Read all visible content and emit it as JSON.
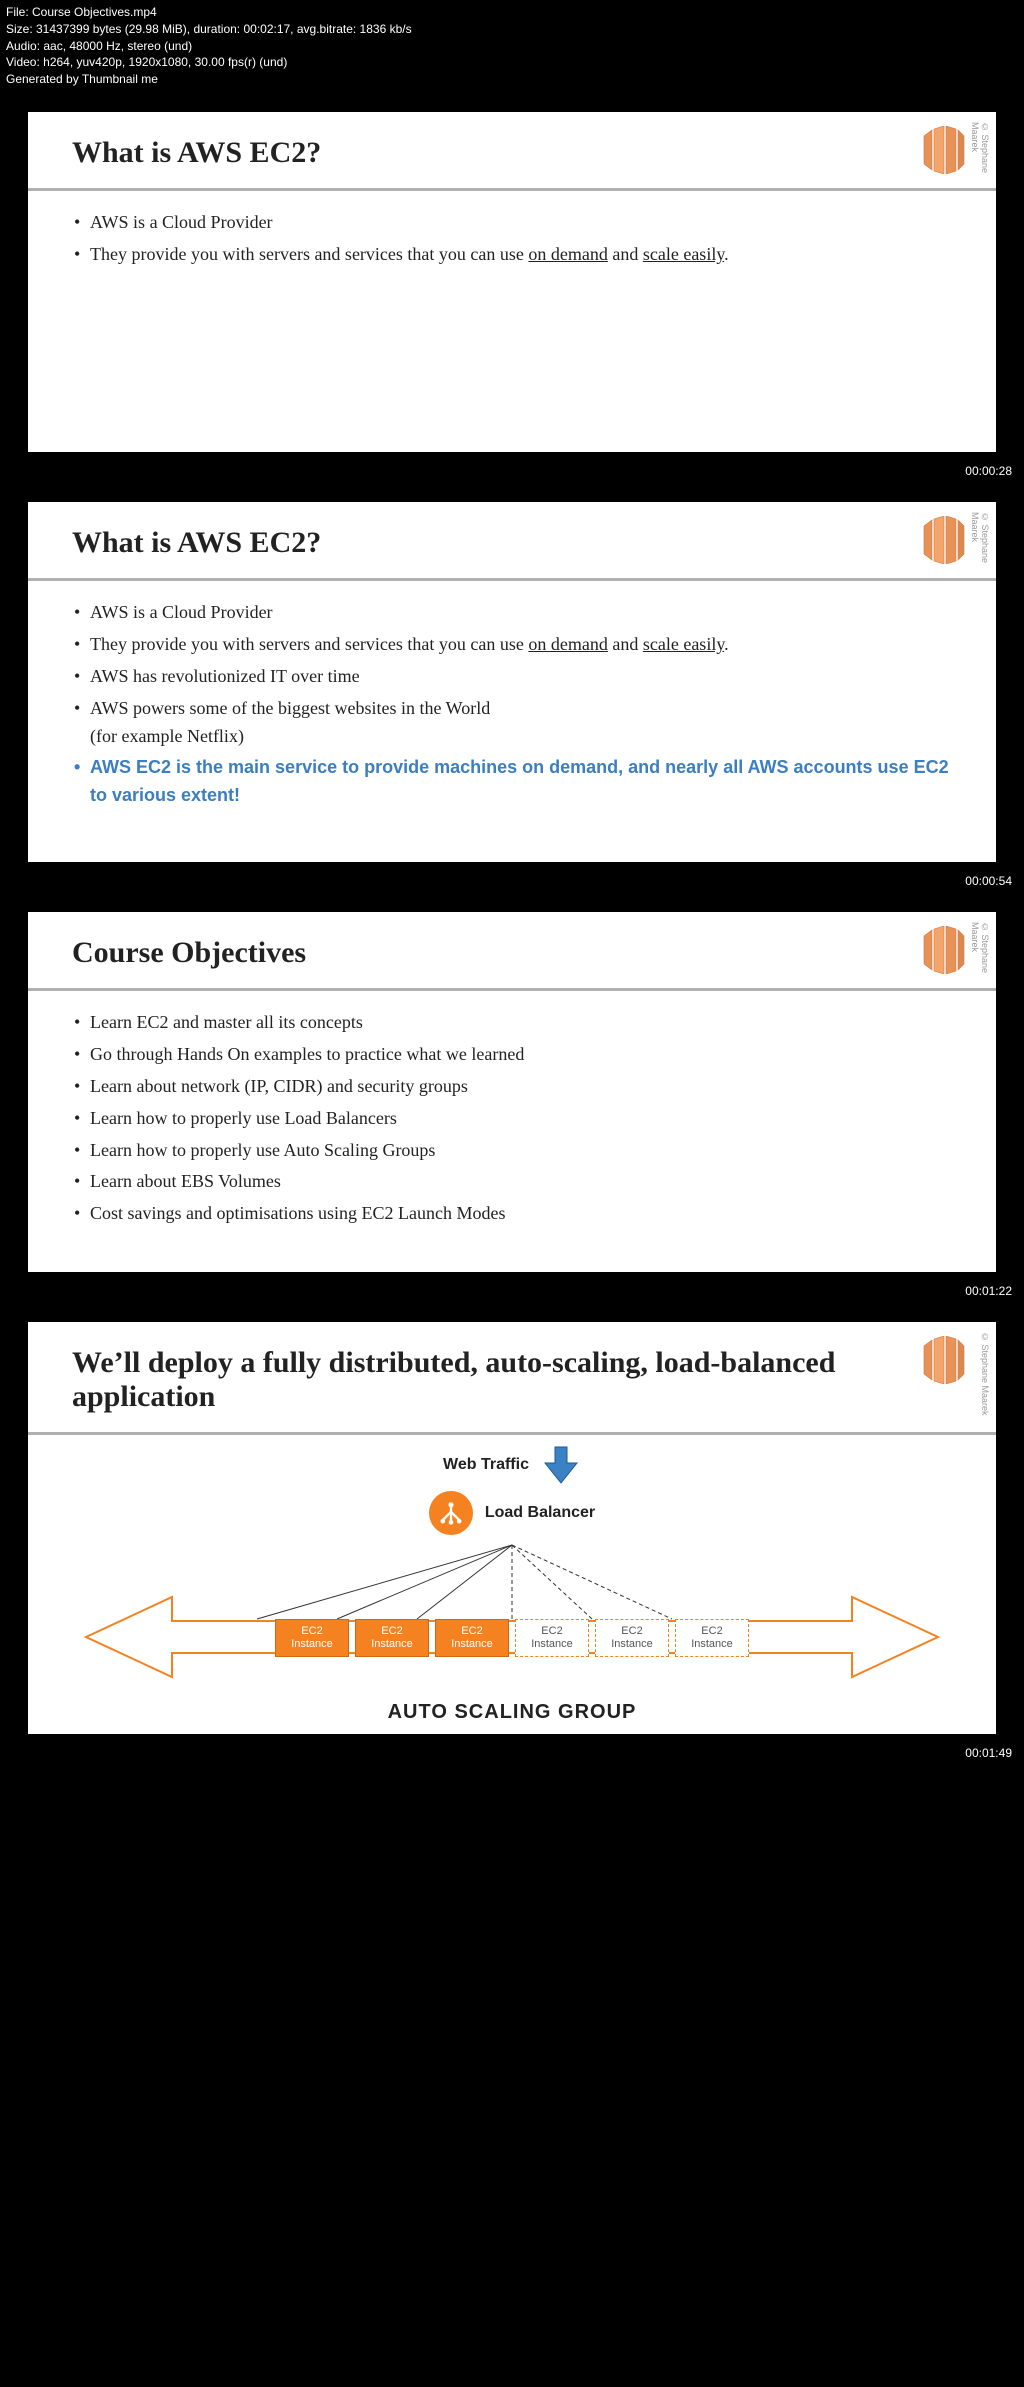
{
  "meta": {
    "file": "File: Course Objectives.mp4",
    "size": "Size: 31437399 bytes (29.98 MiB), duration: 00:02:17, avg.bitrate: 1836 kb/s",
    "audio": "Audio: aac, 48000 Hz, stereo (und)",
    "video": "Video: h264, yuv420p, 1920x1080, 30.00 fps(r) (und)",
    "generated": "Generated by Thumbnail me"
  },
  "copyright": "© Stephane Maarek",
  "slides": [
    {
      "title": "What is AWS EC2?",
      "bullets": [
        {
          "parts": [
            "AWS is a Cloud Provider"
          ]
        },
        {
          "parts": [
            "They provide you with servers and services that you can use ",
            {
              "u": "on demand"
            },
            " and ",
            {
              "u": "scale easily"
            },
            "."
          ]
        }
      ],
      "timestamp": "00:00:28"
    },
    {
      "title": "What is AWS EC2?",
      "bullets": [
        {
          "parts": [
            "AWS is a Cloud Provider"
          ]
        },
        {
          "parts": [
            "They provide you with servers and services that you can use ",
            {
              "u": "on demand"
            },
            " and ",
            {
              "u": "scale easily"
            },
            "."
          ]
        },
        {
          "parts": [
            "AWS has revolutionized IT over time"
          ]
        },
        {
          "parts": [
            "AWS powers some of the biggest websites in the World",
            {
              "br": true
            },
            "(for example Netflix)"
          ]
        },
        {
          "highlight": true,
          "parts": [
            "AWS EC2 is the main service to provide machines on demand, and nearly all AWS accounts use EC2 to various extent!"
          ]
        }
      ],
      "timestamp": "00:00:54"
    },
    {
      "title": "Course Objectives",
      "bullets": [
        {
          "parts": [
            "Learn EC2 and master all its concepts"
          ]
        },
        {
          "parts": [
            "Go through Hands On examples to practice what we learned"
          ]
        },
        {
          "parts": [
            "Learn about network (IP, CIDR) and security groups"
          ]
        },
        {
          "parts": [
            "Learn how to properly use Load Balancers"
          ]
        },
        {
          "parts": [
            "Learn how to properly use Auto Scaling Groups"
          ]
        },
        {
          "parts": [
            "Learn about EBS Volumes"
          ]
        },
        {
          "parts": [
            "Cost savings and optimisations using EC2 Launch Modes"
          ]
        }
      ],
      "timestamp": "00:01:22"
    },
    {
      "title": "We’ll deploy a fully distributed, auto-scaling, load-balanced application",
      "diagram": {
        "web_traffic": "Web Traffic",
        "load_balancer": "Load Balancer",
        "instances": [
          {
            "label1": "EC2",
            "label2": "Instance",
            "solid": true
          },
          {
            "label1": "EC2",
            "label2": "Instance",
            "solid": true
          },
          {
            "label1": "EC2",
            "label2": "Instance",
            "solid": true
          },
          {
            "label1": "EC2",
            "label2": "Instance",
            "solid": false
          },
          {
            "label1": "EC2",
            "label2": "Instance",
            "solid": false
          },
          {
            "label1": "EC2",
            "label2": "Instance",
            "solid": false
          }
        ],
        "asg_label": "AUTO SCALING GROUP"
      },
      "timestamp": "00:01:49"
    }
  ]
}
